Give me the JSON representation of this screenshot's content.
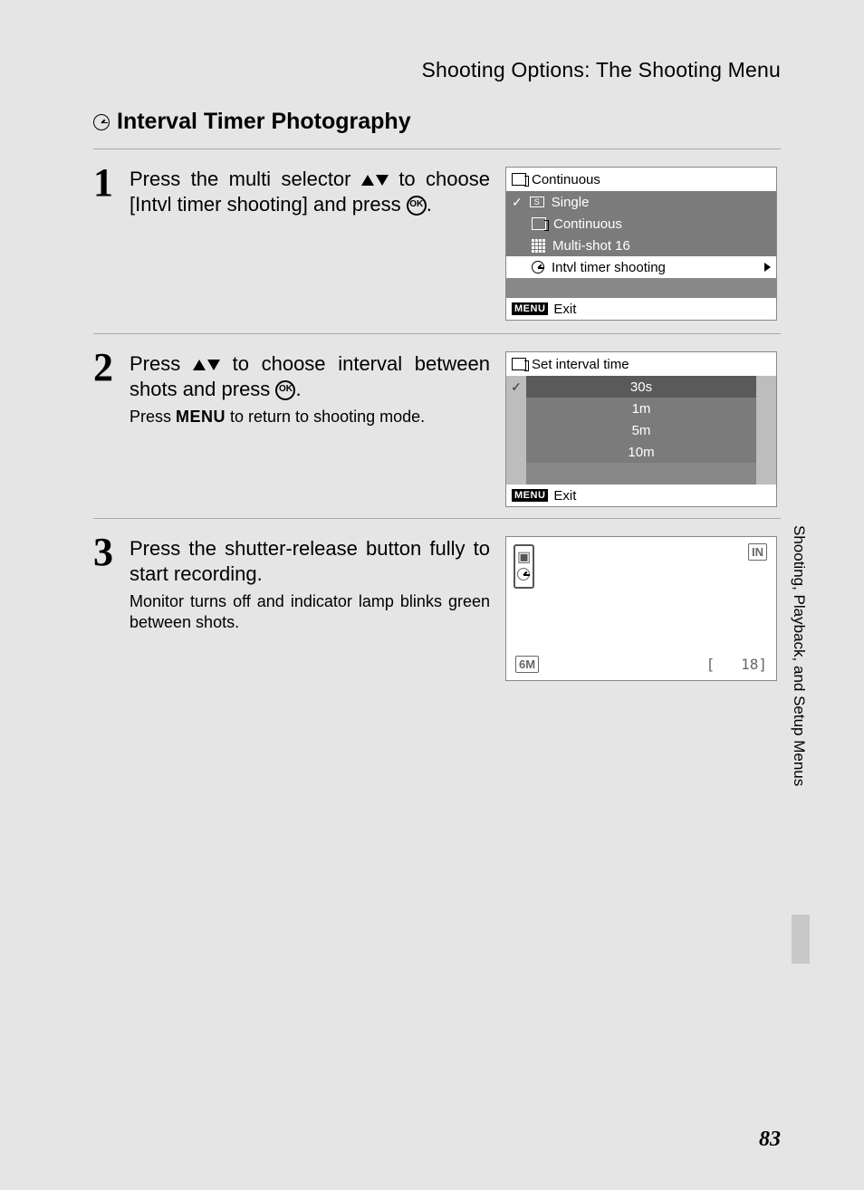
{
  "header": {
    "title": "Shooting Options: The Shooting Menu"
  },
  "section_title": "Interval Timer Photography",
  "steps": {
    "s1": {
      "num": "1",
      "line1a": "Press the multi selector ",
      "line1b": " to choose [Intvl timer shooting] and press ",
      "line1c": "."
    },
    "s2": {
      "num": "2",
      "line1a": "Press ",
      "line1b": " to choose interval between shots and press ",
      "line1c": ".",
      "sub_a": "Press ",
      "sub_b": " to return to shooting mode."
    },
    "s3": {
      "num": "3",
      "line1": "Press the shutter-release button fully to start recording.",
      "sub": "Monitor turns off and indicator lamp blinks green between shots."
    }
  },
  "menu_label": "MENU",
  "ok_label": "OK",
  "screen1": {
    "title": "Continuous",
    "items": [
      "Single",
      "Continuous",
      "Multi-shot 16",
      "Intvl timer shooting"
    ],
    "exit": "Exit"
  },
  "screen2": {
    "title": "Set interval time",
    "items": [
      "30s",
      "1m",
      "5m",
      "10m"
    ],
    "exit": "Exit"
  },
  "screen3": {
    "size_label": "6M",
    "in_label": "IN",
    "count": "18"
  },
  "sidebar_text": "Shooting, Playback, and Setup Menus",
  "page_number": "83"
}
